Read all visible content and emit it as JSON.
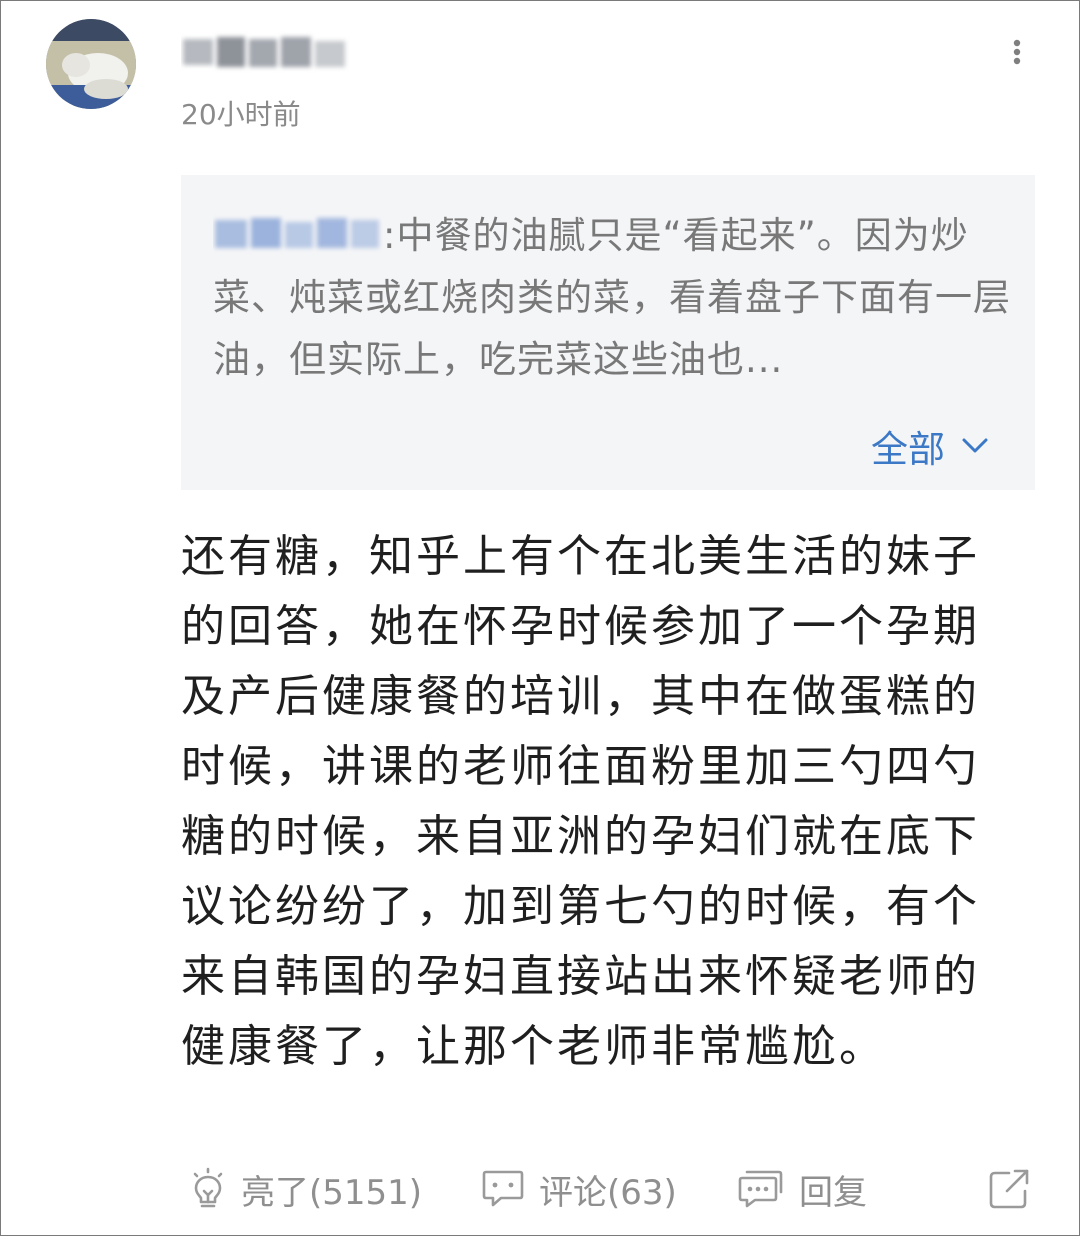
{
  "post": {
    "time": "20小时前"
  },
  "quote": {
    "separator": ":",
    "text": "中餐的油腻只是“看起来”。因为炒菜、炖菜或红烧肉类的菜，看着盘子下面有一层油，但实际上，吃完菜这些油也...",
    "expand_label": "全部"
  },
  "content": {
    "text": "还有糖，知乎上有个在北美生活的妹子的回答，她在怀孕时候参加了一个孕期及产后健康餐的培训，其中在做蛋糕的时候，讲课的老师往面粉里加三勺四勺糖的时候，来自亚洲的孕妇们就在底下议论纷纷了，加到第七勺的时候，有个来自韩国的孕妇直接站出来怀疑老师的健康餐了，让那个老师非常尴尬。"
  },
  "actions": {
    "like_label": "亮了(5151)",
    "comment_label": "评论(63)",
    "reply_label": "回复"
  },
  "colors": {
    "accent": "#3b78c6",
    "muted": "#8f8f8f",
    "quote_bg": "#f4f5f7",
    "text": "#1f1f1f"
  },
  "icons": [
    "more-vertical-icon",
    "chevron-down-icon",
    "lightbulb-icon",
    "comment-icon",
    "reply-icon",
    "share-icon"
  ]
}
